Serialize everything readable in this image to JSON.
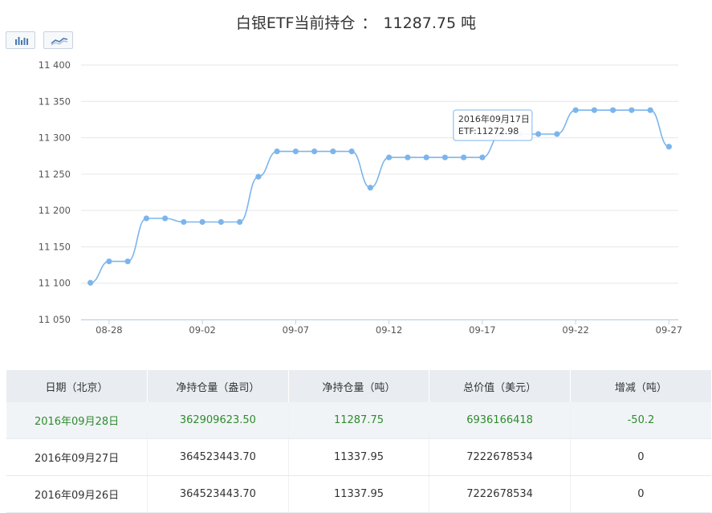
{
  "title": {
    "name": "白银ETF当前持仓",
    "separator": "：",
    "value": "11287.75",
    "unit": "吨"
  },
  "toolbar": {
    "bar_icon": "bar-chart-icon",
    "line_icon": "line-chart-icon"
  },
  "colors": {
    "series": "#7cb5ec",
    "grid": "#e6e6e6",
    "table_header_bg": "#e9edf2",
    "highlight_text": "#2e8b2e"
  },
  "chart_data": {
    "type": "line",
    "x": [
      "08-27",
      "08-28",
      "08-29",
      "08-30",
      "08-31",
      "09-01",
      "09-02",
      "09-03",
      "09-04",
      "09-05",
      "09-06",
      "09-07",
      "09-08",
      "09-09",
      "09-10",
      "09-11",
      "09-12",
      "09-13",
      "09-14",
      "09-15",
      "09-16",
      "09-17",
      "09-18",
      "09-19",
      "09-20",
      "09-21",
      "09-22",
      "09-23",
      "09-24",
      "09-25",
      "09-26",
      "09-27"
    ],
    "series": [
      {
        "values": [
          11100.53,
          11129.94,
          11129.94,
          11189.11,
          11189.11,
          11184.16,
          11184.16,
          11184.16,
          11184.16,
          11246.38,
          11281.25,
          11281.25,
          11281.25,
          11281.25,
          11281.25,
          11231.32,
          11272.98,
          11272.98,
          11272.98,
          11272.98,
          11272.98,
          11272.98,
          11305.04,
          11305.04,
          11305.04,
          11305.04,
          11337.95,
          11337.95,
          11337.95,
          11337.95,
          11337.95,
          11287.75
        ]
      }
    ],
    "xticks": [
      "08-28",
      "09-02",
      "09-07",
      "09-12",
      "09-17",
      "09-22",
      "09-27"
    ],
    "yticks": [
      "11 050",
      "11 100",
      "11 150",
      "11 200",
      "11 250",
      "11 300",
      "11 350",
      "11 400"
    ],
    "ylim": [
      11050,
      11400
    ],
    "grid": true,
    "tooltip": {
      "date": "2016年09月17日",
      "text": "ETF:11272.98",
      "index": 21
    }
  },
  "table": {
    "headers": [
      "日期（北京）",
      "净持仓量（盎司）",
      "净持仓量（吨）",
      "总价值（美元）",
      "增减（吨）"
    ],
    "rows": [
      [
        "2016年09月28日",
        "362909623.50",
        "11287.75",
        "6936166418",
        "-50.2"
      ],
      [
        "2016年09月27日",
        "364523443.70",
        "11337.95",
        "7222678534",
        "0"
      ],
      [
        "2016年09月26日",
        "364523443.70",
        "11337.95",
        "7222678534",
        "0"
      ]
    ]
  }
}
